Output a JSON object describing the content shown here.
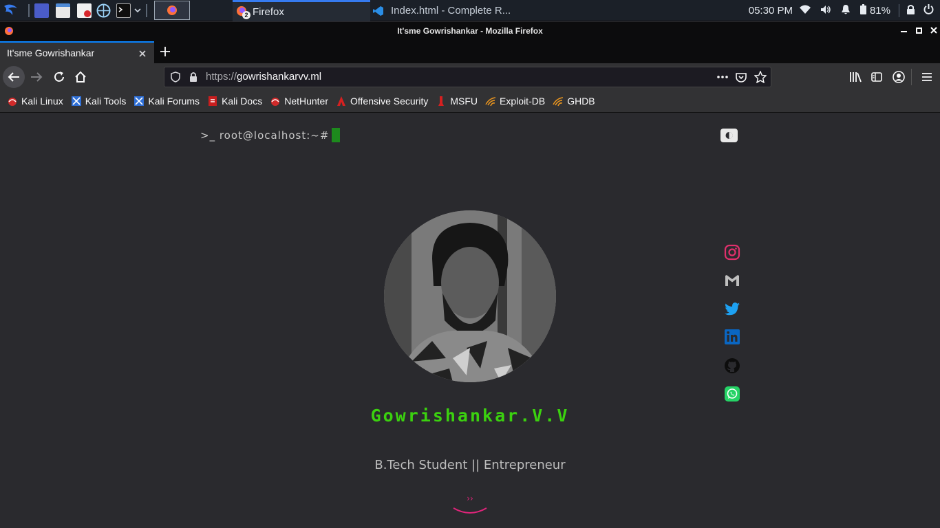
{
  "panel": {
    "tasks": [
      {
        "label": "Firefox",
        "badge": "2"
      },
      {
        "label": "Index.html - Complete R..."
      }
    ],
    "clock": "05:30 PM",
    "battery": "81%"
  },
  "window": {
    "title": "It'sme Gowrishankar - Mozilla Firefox"
  },
  "tabs": [
    {
      "label": "It'sme Gowrishankar"
    }
  ],
  "urlbar": {
    "scheme": "https://",
    "host": "gowrishankarvv.ml"
  },
  "bookmarks": [
    {
      "label": "Kali Linux",
      "icon": "kali-dragon-icon"
    },
    {
      "label": "Kali Tools",
      "icon": "kali-tools-icon"
    },
    {
      "label": "Kali Forums",
      "icon": "kali-forums-icon"
    },
    {
      "label": "Kali Docs",
      "icon": "kali-docs-icon"
    },
    {
      "label": "NetHunter",
      "icon": "nethunter-icon"
    },
    {
      "label": "Offensive Security",
      "icon": "offsec-icon"
    },
    {
      "label": "MSFU",
      "icon": "msfu-icon"
    },
    {
      "label": "Exploit-DB",
      "icon": "exploitdb-icon"
    },
    {
      "label": "GHDB",
      "icon": "ghdb-icon"
    }
  ],
  "page": {
    "prompt": ">_ root@localhost:~#",
    "name": "Gowrishankar.V.V",
    "tagline": "B.Tech Student || Entrepreneur",
    "scroll_label": "››",
    "social": [
      "instagram",
      "gmail",
      "twitter",
      "linkedin",
      "github",
      "whatsapp"
    ]
  },
  "colors": {
    "accent_blue": "#0a84ff",
    "name_green": "#3bd10f",
    "cursor_green": "#1d8a1d",
    "scroll_pink": "#e0247a",
    "instagram": "#e1306c",
    "twitter": "#1da1f2",
    "linkedin": "#0a66c2",
    "whatsapp": "#25d366"
  }
}
